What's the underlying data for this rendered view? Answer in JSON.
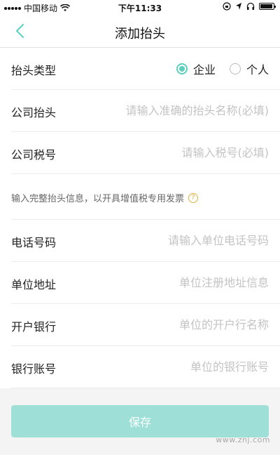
{
  "status_bar": {
    "carrier": "中国移动",
    "time": "下午11:33"
  },
  "nav": {
    "title": "添加抬头"
  },
  "form": {
    "type_label": "抬头类型",
    "type_options": [
      "企业",
      "个人"
    ],
    "type_selected": "企业",
    "company_title_label": "公司抬头",
    "company_title_placeholder": "请输入准确的抬头名称(必填)",
    "tax_no_label": "公司税号",
    "tax_no_placeholder": "请输入税号(必填)",
    "hint": "输入完整抬头信息，以开具增值税专用发票",
    "phone_label": "电话号码",
    "phone_placeholder": "请输入单位电话号码",
    "address_label": "单位地址",
    "address_placeholder": "单位注册地址信息",
    "bank_label": "开户银行",
    "bank_placeholder": "单位的开户行名称",
    "account_label": "银行账号",
    "account_placeholder": "单位的银行账号"
  },
  "save_label": "保存",
  "watermark": "www.znj.com",
  "colors": {
    "accent": "#5ccfbd",
    "button": "#9ee0d7",
    "hint_icon": "#e2b13c"
  },
  "icons": [
    "wifi-icon",
    "battery-icon",
    "back-arrow-icon",
    "help-icon"
  ]
}
